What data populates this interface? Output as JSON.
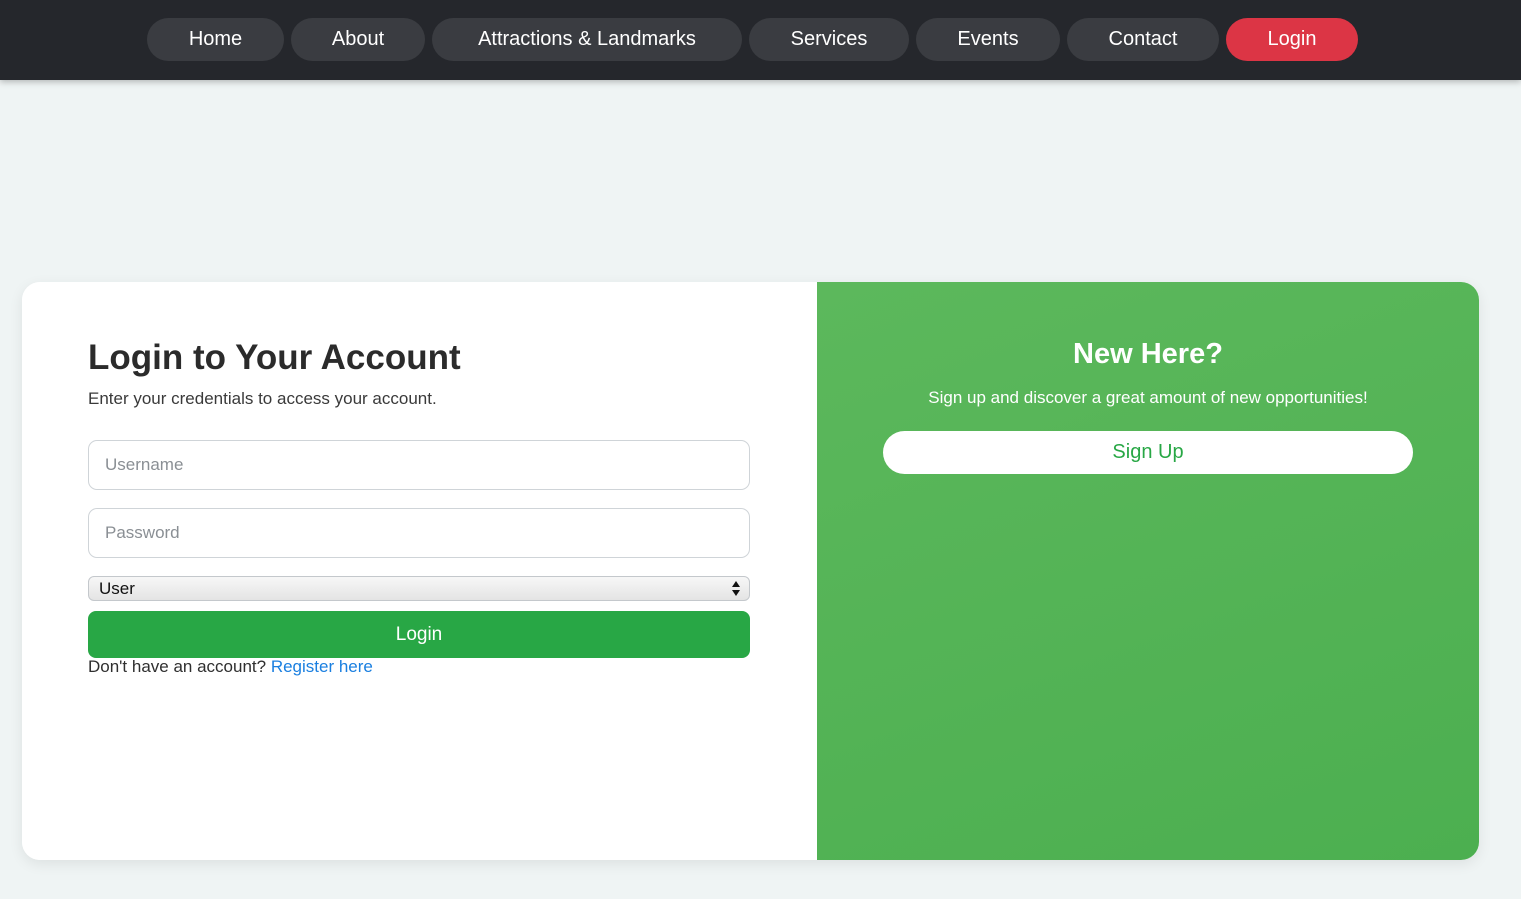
{
  "nav": {
    "items": [
      {
        "label": "Home"
      },
      {
        "label": "About"
      },
      {
        "label": "Attractions & Landmarks"
      },
      {
        "label": "Services"
      },
      {
        "label": "Events"
      },
      {
        "label": "Contact"
      },
      {
        "label": "Login"
      }
    ],
    "active_color": "#dc3545"
  },
  "login": {
    "title": "Login to Your Account",
    "subtitle": "Enter your credentials to access your account.",
    "username_placeholder": "Username",
    "password_placeholder": "Password",
    "role_selected": "User",
    "button_label": "Login",
    "register_prompt": "Don't have an account?",
    "register_link": "Register here"
  },
  "signup": {
    "title": "New Here?",
    "subtitle": "Sign up and discover a great amount of new opportunities!",
    "button_label": "Sign Up"
  },
  "colors": {
    "nav_bg": "#25272c",
    "primary_green": "#28a745",
    "panel_green": "#5cb85c",
    "link_blue": "#1a7fe0"
  }
}
